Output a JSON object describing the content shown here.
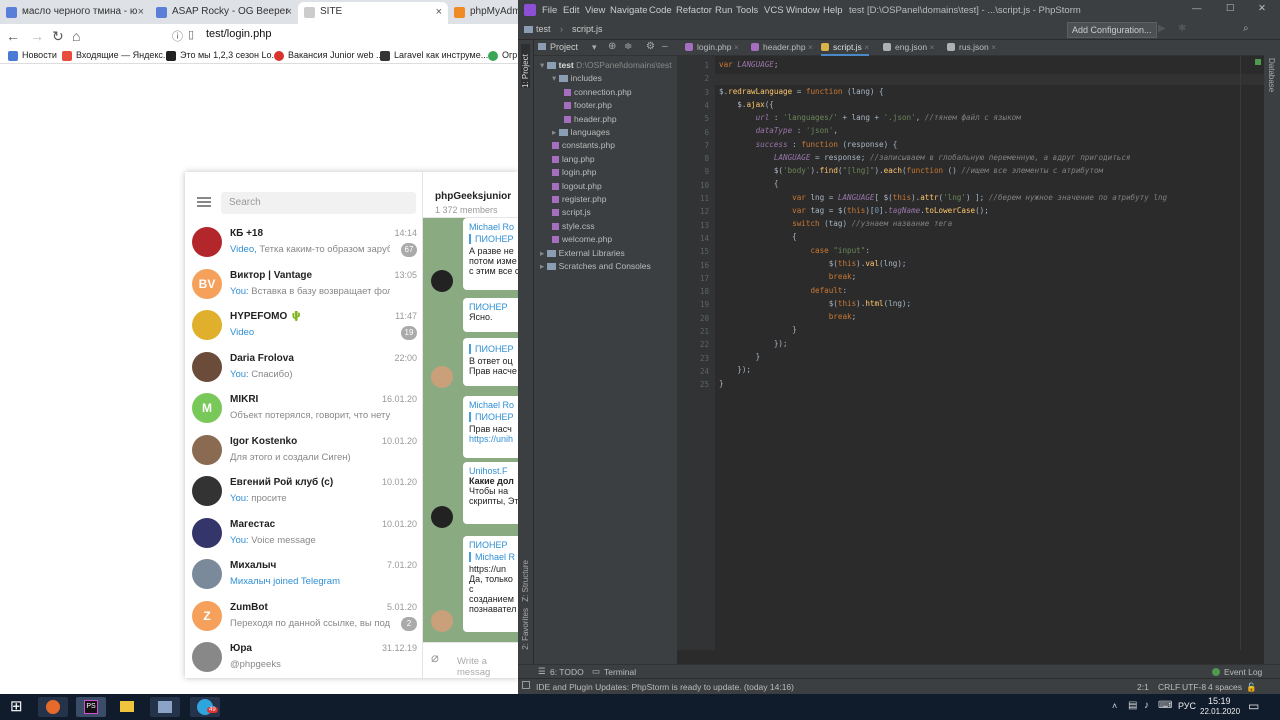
{
  "browser": {
    "tabs": [
      {
        "label": "масло черного тмина - ю",
        "color": "#5b7fd9"
      },
      {
        "label": "ASAP Rocky - OG Beeper",
        "color": "#5b7fd9"
      },
      {
        "label": "SITE",
        "color": "#999999"
      },
      {
        "label": "phpMyAdmi",
        "color": "#f08a24"
      }
    ],
    "url": "test/login.php",
    "bookmarks": [
      {
        "label": "Новости",
        "color": "#4a7bd4"
      },
      {
        "label": "Входящие — Яндекс...",
        "color": "#e74c3c"
      },
      {
        "label": "Это мы 1,2,3 сезон Lo...",
        "color": "#222222"
      },
      {
        "label": "Вакансия Junior web ...",
        "color": "#d9342b"
      },
      {
        "label": "Laravel как инструме...",
        "color": "#333333"
      },
      {
        "label": "Огр",
        "color": "#3aa757"
      }
    ]
  },
  "telegram": {
    "search_placeholder": "Search",
    "chats": [
      {
        "name": "КБ +18",
        "time": "14:14",
        "prefix": "Video,",
        "preview": " Тетка каким-то образом заруби...",
        "badge": "67",
        "avatar": "",
        "avcolor": "#b3262b"
      },
      {
        "name": "Виктор | Vantage",
        "time": "13:05",
        "prefix": "You:",
        "preview": " Вставка в базу возвращает фолс Хотя...",
        "badge": "",
        "avatar": "BV",
        "avcolor": "#f5a15c"
      },
      {
        "name": "HYPEFOMO 🌵",
        "time": "11:47",
        "prefix": "Video",
        "preview": "",
        "badge": "19",
        "avatar": "",
        "avcolor": "#e0b02c"
      },
      {
        "name": "Daria Frolova",
        "time": "22:00",
        "prefix": "You:",
        "preview": " Спасибо)",
        "badge": "",
        "avatar": "",
        "avcolor": "#6b4b3a"
      },
      {
        "name": "MIKRI",
        "time": "16.01.20",
        "prefix": "",
        "preview": "Объект потерялся, говорит, что нету 🙀",
        "badge": "",
        "avatar": "M",
        "avcolor": "#78c85a"
      },
      {
        "name": "Igor Kostenko",
        "time": "10.01.20",
        "prefix": "",
        "preview": "Для этого и создали Сиген)",
        "badge": "",
        "avatar": "",
        "avcolor": "#8a6a50"
      },
      {
        "name": "Евгений Рой клуб (с)",
        "time": "10.01.20",
        "prefix": "You:",
        "preview": " просите",
        "badge": "",
        "avatar": "",
        "avcolor": "#333333"
      },
      {
        "name": "Магестас",
        "time": "10.01.20",
        "prefix": "You:",
        "preview": " Voice message",
        "badge": "",
        "avatar": "",
        "avcolor": "#34356b"
      },
      {
        "name": "Михалыч",
        "time": "7.01.20",
        "prefix": "Михалыч joined Telegram",
        "preview": "",
        "badge": "",
        "avatar": "",
        "avcolor": "#7a8a9a"
      },
      {
        "name": "ZumBot",
        "time": "5.01.20",
        "prefix": "",
        "preview": "Переходя по данной ссылке, вы подтве...",
        "badge": "2",
        "avatar": "Z",
        "avcolor": "#f5a15c"
      },
      {
        "name": "Юра",
        "time": "31.12.19",
        "prefix": "",
        "preview": "@phpgeeks",
        "badge": "",
        "avatar": "",
        "avcolor": "#888888"
      }
    ],
    "channel_name": "phpGeeksjunior",
    "channel_members": "1 372 members",
    "messages": [
      {
        "author": "Michael Ro",
        "quote": "ПИОНЕР",
        "text": "А разве не",
        "extra": "потом изме",
        "extra2": "с этим все с"
      },
      {
        "author": "ПИОНЕР",
        "quote": "",
        "text": "Ясно.",
        "extra": "",
        "extra2": ""
      },
      {
        "author": "",
        "quote": "ПИОНЕР",
        "text": "В ответ оц",
        "extra": "Прав насче",
        "extra2": ""
      },
      {
        "author": "Michael Ro",
        "quote": "ПИОНЕР",
        "text": "Прав насч",
        "extra": "https://unih",
        "extra2": ""
      },
      {
        "author": "Unihost.F",
        "quote": "",
        "text": "Какие дол",
        "extra": "Чтобы на",
        "extra2": "скрипты, Это огран"
      },
      {
        "author": "ПИОНЕР",
        "quote": "Michael R",
        "text": "https://un",
        "extra": "Да, только с созданием познавател",
        "extra2": ""
      }
    ],
    "input_placeholder": "Write a messag"
  },
  "ide": {
    "menu": [
      "File",
      "Edit",
      "View",
      "Navigate",
      "Code",
      "Refactor",
      "Run",
      "Tools",
      "VCS",
      "Window",
      "Help"
    ],
    "title": "test [D:\\OSPanel\\domains\\test] - ...\\script.js - PhpStorm",
    "breadcrumb_project": "test",
    "breadcrumb_file": "script.js",
    "run_config": "Add Configuration...",
    "project_label": "Project",
    "left_tool_project": "1: Project",
    "left_tool_structure": "Z: Structure",
    "left_tool_favorites": "2: Favorites",
    "right_tool": "Database",
    "tree": [
      {
        "label": "test",
        "extra": "D:\\OSPanel\\domains\\test",
        "indent": 0,
        "type": "folder"
      },
      {
        "label": "includes",
        "extra": "",
        "indent": 1,
        "type": "folder"
      },
      {
        "label": "connection.php",
        "extra": "",
        "indent": 2,
        "type": "file"
      },
      {
        "label": "footer.php",
        "extra": "",
        "indent": 2,
        "type": "file"
      },
      {
        "label": "header.php",
        "extra": "",
        "indent": 2,
        "type": "file"
      },
      {
        "label": "languages",
        "extra": "",
        "indent": 1,
        "type": "folder"
      },
      {
        "label": "constants.php",
        "extra": "",
        "indent": 1,
        "type": "file"
      },
      {
        "label": "lang.php",
        "extra": "",
        "indent": 1,
        "type": "file"
      },
      {
        "label": "login.php",
        "extra": "",
        "indent": 1,
        "type": "file"
      },
      {
        "label": "logout.php",
        "extra": "",
        "indent": 1,
        "type": "file"
      },
      {
        "label": "register.php",
        "extra": "",
        "indent": 1,
        "type": "file"
      },
      {
        "label": "script.js",
        "extra": "",
        "indent": 1,
        "type": "file"
      },
      {
        "label": "style.css",
        "extra": "",
        "indent": 1,
        "type": "file"
      },
      {
        "label": "welcome.php",
        "extra": "",
        "indent": 1,
        "type": "file"
      },
      {
        "label": "External Libraries",
        "extra": "",
        "indent": 0,
        "type": "folder"
      },
      {
        "label": "Scratches and Consoles",
        "extra": "",
        "indent": 0,
        "type": "folder"
      }
    ],
    "tabs": [
      "login.php",
      "header.php",
      "script.js",
      "eng.json",
      "rus.json"
    ],
    "active_tab": 2,
    "bottom_todo": "6: TODO",
    "bottom_terminal": "Terminal",
    "event_log": "Event Log",
    "status_msg": "IDE and Plugin Updates: PhpStorm is ready to update. (today 14:16)",
    "status_pos": "2:1",
    "status_crlf": "CRLF",
    "status_enc": "UTF-8",
    "status_indent": "4 spaces"
  },
  "taskbar": {
    "lang": "РУС",
    "time": "15:19",
    "date": "22.01.2020",
    "tg_badge": "49"
  }
}
